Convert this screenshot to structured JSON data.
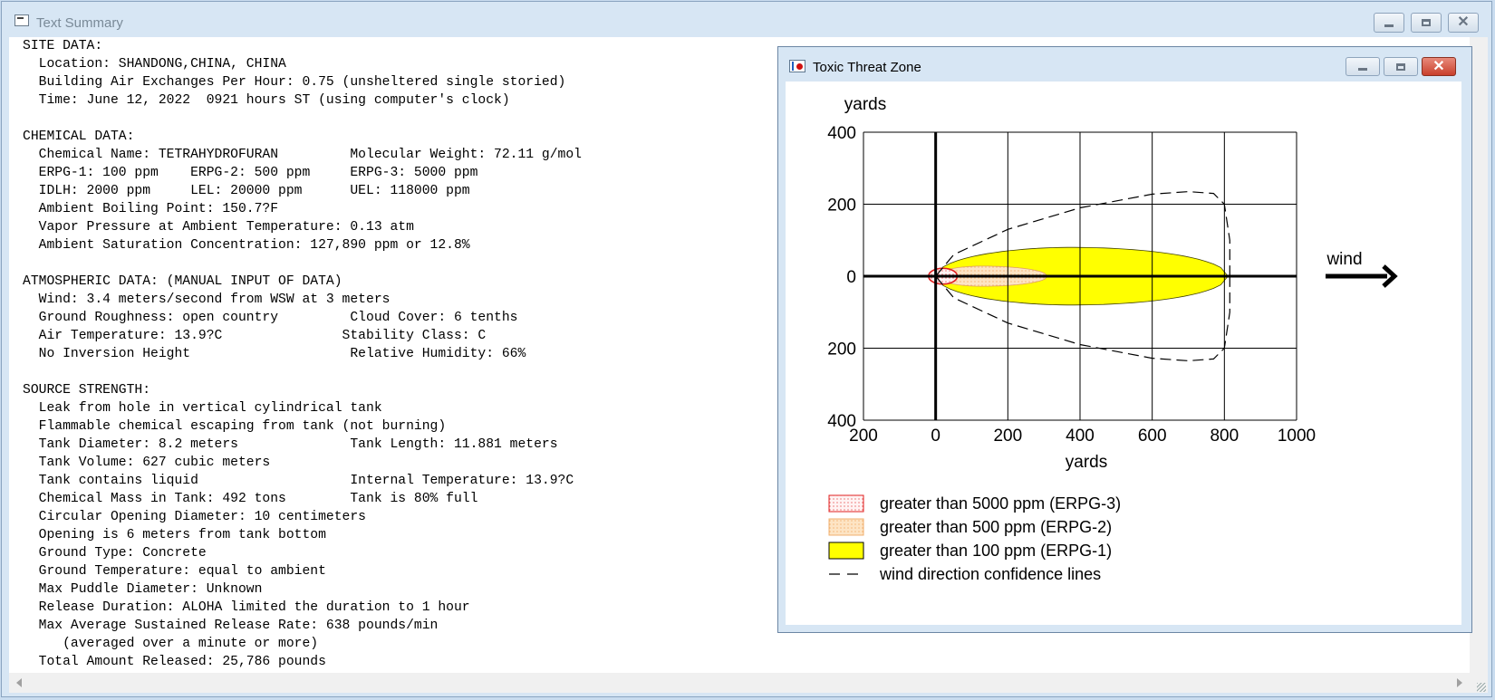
{
  "window": {
    "title": "Text Summary"
  },
  "report_lines": [
    "SITE DATA:",
    "  Location: SHANDONG,CHINA, CHINA",
    "  Building Air Exchanges Per Hour: 0.75 (unsheltered single storied)",
    "  Time: June 12, 2022  0921 hours ST (using computer's clock)",
    "",
    "CHEMICAL DATA:",
    "  Chemical Name: TETRAHYDROFURAN         Molecular Weight: 72.11 g/mol",
    "  ERPG-1: 100 ppm    ERPG-2: 500 ppm     ERPG-3: 5000 ppm",
    "  IDLH: 2000 ppm     LEL: 20000 ppm      UEL: 118000 ppm",
    "  Ambient Boiling Point: 150.7?F",
    "  Vapor Pressure at Ambient Temperature: 0.13 atm",
    "  Ambient Saturation Concentration: 127,890 ppm or 12.8%",
    "",
    "ATMOSPHERIC DATA: (MANUAL INPUT OF DATA)",
    "  Wind: 3.4 meters/second from WSW at 3 meters",
    "  Ground Roughness: open country         Cloud Cover: 6 tenths",
    "  Air Temperature: 13.9?C               Stability Class: C",
    "  No Inversion Height                    Relative Humidity: 66%",
    "",
    "SOURCE STRENGTH:",
    "  Leak from hole in vertical cylindrical tank",
    "  Flammable chemical escaping from tank (not burning)",
    "  Tank Diameter: 8.2 meters              Tank Length: 11.881 meters",
    "  Tank Volume: 627 cubic meters",
    "  Tank contains liquid                   Internal Temperature: 13.9?C",
    "  Chemical Mass in Tank: 492 tons        Tank is 80% full",
    "  Circular Opening Diameter: 10 centimeters",
    "  Opening is 6 meters from tank bottom",
    "  Ground Type: Concrete",
    "  Ground Temperature: equal to ambient",
    "  Max Puddle Diameter: Unknown",
    "  Release Duration: ALOHA limited the duration to 1 hour",
    "  Max Average Sustained Release Rate: 638 pounds/min",
    "     (averaged over a minute or more)",
    "  Total Amount Released: 25,786 pounds"
  ],
  "child_window": {
    "title": "Toxic Threat Zone"
  },
  "chart_data": {
    "type": "area",
    "ylabel": "yards",
    "xlabel": "yards",
    "xlim": [
      -200,
      1000
    ],
    "ylim": [
      -400,
      400
    ],
    "x_ticks": [
      {
        "value": -200,
        "label": "200"
      },
      {
        "value": 0,
        "label": "0"
      },
      {
        "value": 200,
        "label": "200"
      },
      {
        "value": 400,
        "label": "400"
      },
      {
        "value": 600,
        "label": "600"
      },
      {
        "value": 800,
        "label": "800"
      },
      {
        "value": 1000,
        "label": "1000"
      }
    ],
    "y_ticks": [
      {
        "value": 400,
        "label": "400"
      },
      {
        "value": 200,
        "label": "200"
      },
      {
        "value": 0,
        "label": "0"
      },
      {
        "value": -200,
        "label": "200"
      },
      {
        "value": -400,
        "label": "400"
      }
    ],
    "grid": true,
    "wind_label": "wind",
    "zones": [
      {
        "name": "greater than 100 ppm (ERPG-1)",
        "x_start": 0,
        "x_end": 810,
        "max_halfwidth": 80,
        "x_at_max": 380,
        "fill": "#ffff00"
      },
      {
        "name": "greater than 500 ppm (ERPG-2)",
        "x_start": 0,
        "x_end": 310,
        "max_halfwidth": 28,
        "x_at_max": 130,
        "fill": "#fde0b8"
      },
      {
        "name": "greater than 5000 ppm (ERPG-3)",
        "x_start": -20,
        "x_end": 60,
        "max_halfwidth": 22,
        "x_at_max": 20,
        "fill": "#fde8e8"
      }
    ],
    "confidence_lines": {
      "name": "wind direction confidence lines",
      "upper": [
        [
          0,
          0
        ],
        [
          50,
          60
        ],
        [
          200,
          130
        ],
        [
          400,
          190
        ],
        [
          600,
          228
        ],
        [
          700,
          235
        ],
        [
          770,
          230
        ],
        [
          800,
          200
        ],
        [
          815,
          100
        ],
        [
          815,
          0
        ]
      ],
      "lower": [
        [
          0,
          0
        ],
        [
          50,
          -60
        ],
        [
          200,
          -130
        ],
        [
          400,
          -190
        ],
        [
          600,
          -228
        ],
        [
          700,
          -235
        ],
        [
          770,
          -230
        ],
        [
          800,
          -200
        ],
        [
          815,
          -100
        ],
        [
          815,
          0
        ]
      ]
    },
    "legend": [
      {
        "label": "greater than 5000 ppm (ERPG-3)",
        "swatch": "erpg3"
      },
      {
        "label": "greater than 500 ppm (ERPG-2)",
        "swatch": "erpg2"
      },
      {
        "label": "greater than 100 ppm (ERPG-1)",
        "swatch": "erpg1"
      },
      {
        "label": "wind direction confidence lines",
        "swatch": "dash"
      }
    ],
    "colors": {
      "erpg1": "#ffff00",
      "erpg2": "#fde0b8",
      "erpg3_border": "#e02020",
      "axis": "#000000"
    }
  }
}
